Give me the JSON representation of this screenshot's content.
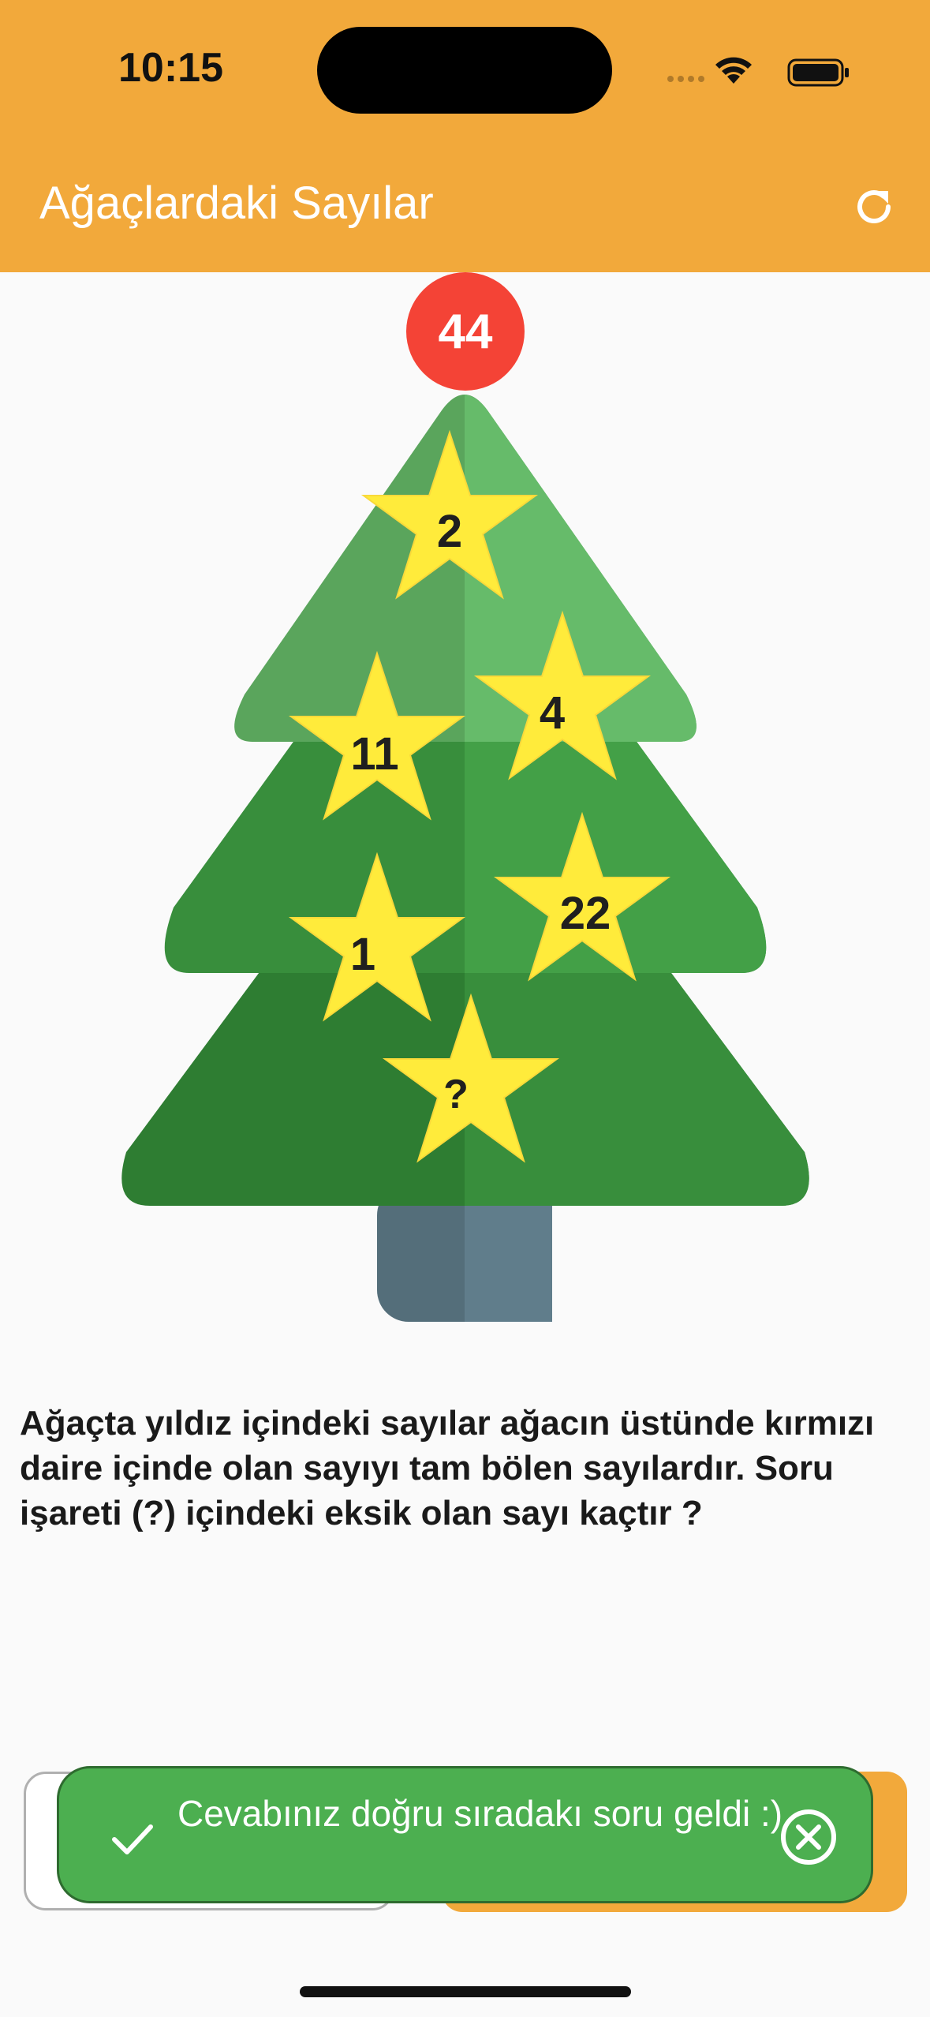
{
  "status_bar": {
    "time": "10:15"
  },
  "app_bar": {
    "title": "Ağaçlardaki Sayılar",
    "refresh_icon": "refresh-icon"
  },
  "puzzle": {
    "target": "44",
    "stars": [
      "2",
      "4",
      "11",
      "22",
      "1",
      "?"
    ]
  },
  "question": "Ağaçta yıldız içindeki sayılar ağacın üstünde kırmızı daire içinde olan sayıyı tam bölen sayılardır. Soru işareti (?) içindeki eksik olan sayı kaçtır ?",
  "toast": {
    "message": "Cevabınız doğru sıradakı soru geldi :)",
    "icon": "check-icon",
    "close_icon": "close-circle-icon"
  },
  "colors": {
    "app_bar": "#f2a93b",
    "badge": "#f44336",
    "toast": "#4caf50",
    "star": "#ffeb3b"
  }
}
